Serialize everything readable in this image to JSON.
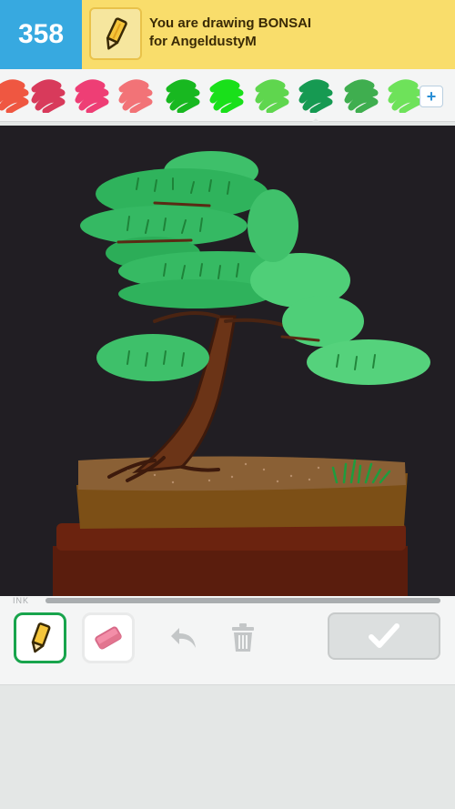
{
  "header": {
    "score": "358",
    "line1": "You are drawing BONSAI",
    "line2": "for AngeldustyM"
  },
  "palette": {
    "colors": [
      "#ef5741",
      "#d83a5b",
      "#ee3e75",
      "#f27377",
      "#18b820",
      "#19e01a",
      "#5fd64e",
      "#169a52",
      "#3fae4f",
      "#6ee25a"
    ],
    "selected": "#169a52",
    "add_label": "+"
  },
  "ink": {
    "label": "INK",
    "level": 1.0
  },
  "tools": {
    "active_tool": "pencil"
  },
  "colors": {
    "score_bg": "#37a9e0",
    "header_bg": "#f9dd6b",
    "canvas_bg": "#211e23",
    "active_border": "#18a44c"
  }
}
